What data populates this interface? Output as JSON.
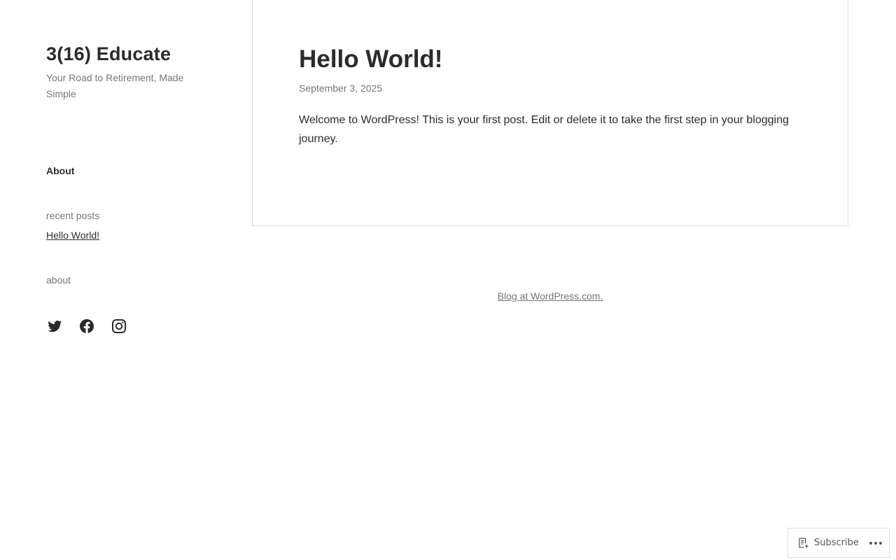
{
  "site": {
    "title": "3(16) Educate",
    "tagline": "Your Road to Retirement, Made Simple"
  },
  "nav": {
    "about_label": "About"
  },
  "widgets": {
    "recent_posts_title": "recent posts",
    "recent_posts": [
      {
        "label": "Hello World!"
      }
    ],
    "about_title": "about",
    "social_icons": [
      "twitter-icon",
      "facebook-icon",
      "instagram-icon"
    ]
  },
  "post": {
    "title": "Hello World!",
    "date": "September 3, 2025",
    "body": "Welcome to WordPress! This is your first post. Edit or delete it to take the first step in your blogging journey."
  },
  "footer": {
    "credit": "Blog at WordPress.com."
  },
  "action_bar": {
    "subscribe_label": "Subscribe",
    "more_icon": "ellipsis-icon"
  },
  "colors": {
    "text": "#2b2b2b",
    "muted": "#767676",
    "border": "#dcdcdc"
  }
}
